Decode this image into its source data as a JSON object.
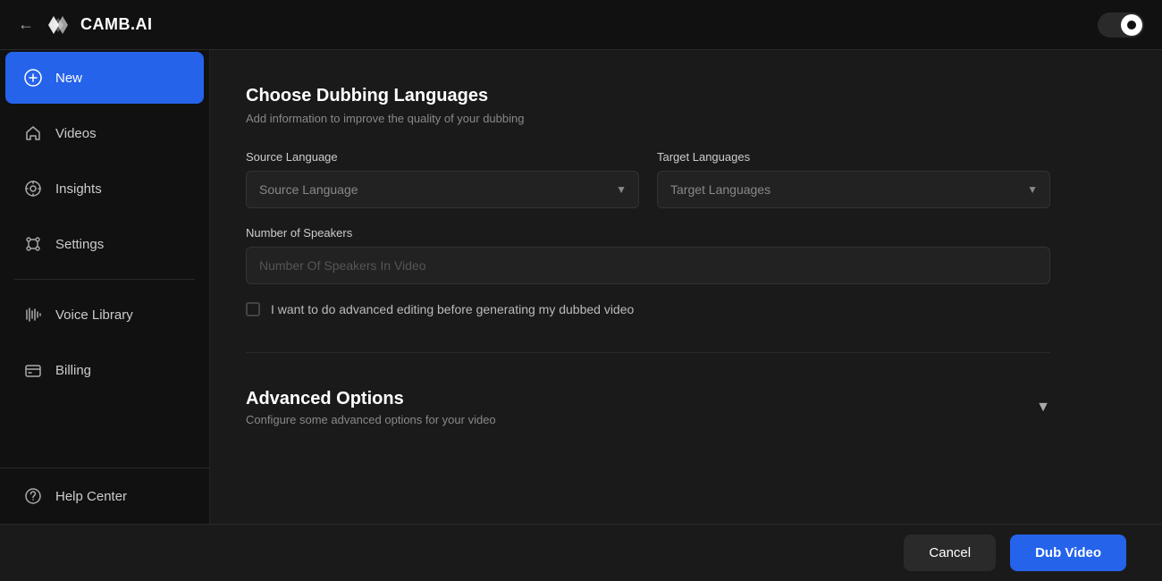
{
  "topbar": {
    "logo_text": "CAMB.AI",
    "back_label": "←",
    "toggle_on": true
  },
  "sidebar": {
    "items": [
      {
        "id": "new",
        "label": "New",
        "active": true
      },
      {
        "id": "videos",
        "label": "Videos",
        "active": false
      },
      {
        "id": "insights",
        "label": "Insights",
        "active": false
      },
      {
        "id": "settings",
        "label": "Settings",
        "active": false
      },
      {
        "id": "voice-library",
        "label": "Voice Library",
        "active": false
      },
      {
        "id": "billing",
        "label": "Billing",
        "active": false
      }
    ],
    "bottom_items": [
      {
        "id": "help-center",
        "label": "Help Center"
      }
    ]
  },
  "main": {
    "dubbing_section": {
      "title": "Choose Dubbing Languages",
      "subtitle": "Add information to improve the quality of your dubbing",
      "source_language_label": "Source Language",
      "source_language_placeholder": "Source Language",
      "target_languages_label": "Target Languages",
      "target_languages_placeholder": "Target Languages",
      "speakers_label": "Number of Speakers",
      "speakers_placeholder": "Number Of Speakers In Video",
      "checkbox_label": "I want to do advanced editing before generating my dubbed video"
    },
    "advanced_section": {
      "title": "Advanced Options",
      "subtitle": "Configure some advanced options for your video"
    }
  },
  "footer": {
    "cancel_label": "Cancel",
    "dub_label": "Dub Video"
  }
}
